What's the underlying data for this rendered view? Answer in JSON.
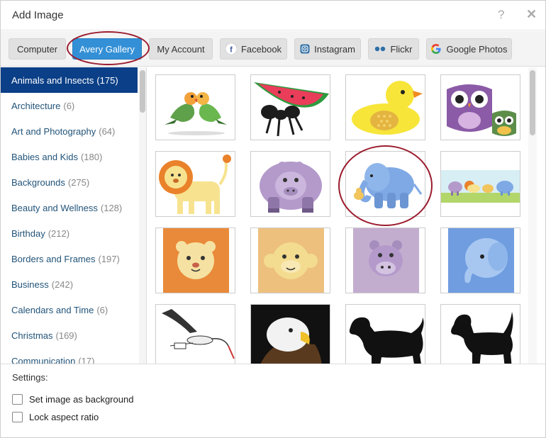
{
  "title": "Add Image",
  "tabs": [
    {
      "label": "Computer",
      "icon": ""
    },
    {
      "label": "Avery Gallery",
      "icon": ""
    },
    {
      "label": "My Account",
      "icon": ""
    },
    {
      "label": "Facebook",
      "icon": "facebook-icon"
    },
    {
      "label": "Instagram",
      "icon": "instagram-icon"
    },
    {
      "label": "Flickr",
      "icon": "flickr-icon"
    },
    {
      "label": "Google Photos",
      "icon": "google-icon"
    }
  ],
  "active_tab": "Avery Gallery",
  "categories": [
    {
      "name": "Animals and Insects",
      "count": "(175)"
    },
    {
      "name": "Architecture",
      "count": "(6)"
    },
    {
      "name": "Art and Photography",
      "count": "(64)"
    },
    {
      "name": "Babies and Kids",
      "count": "(180)"
    },
    {
      "name": "Backgrounds",
      "count": "(275)"
    },
    {
      "name": "Beauty and Wellness",
      "count": "(128)"
    },
    {
      "name": "Birthday",
      "count": "(212)"
    },
    {
      "name": "Borders and Frames",
      "count": "(197)"
    },
    {
      "name": "Business",
      "count": "(242)"
    },
    {
      "name": "Calendars and Time",
      "count": "(6)"
    },
    {
      "name": "Christmas",
      "count": "(169)"
    },
    {
      "name": "Communication",
      "count": "(17)"
    }
  ],
  "active_category": "Animals and Insects",
  "gallery": {
    "images": [
      "lovebirds",
      "watermelon-ant",
      "rubber-duck",
      "owls",
      "lion",
      "hippo",
      "elephant",
      "animal-parade",
      "lion-face",
      "monkey-face",
      "hippo-face",
      "elephant-face",
      "stork",
      "bald-eagle",
      "basset-hound-silhouette",
      "beagle-silhouette"
    ]
  },
  "settings": {
    "title": "Settings:",
    "options": [
      {
        "label": "Set image as background",
        "checked": false
      },
      {
        "label": "Lock aspect ratio",
        "checked": false
      }
    ]
  },
  "colors": {
    "accent": "#3390d6",
    "active_category_bg": "#0b3f87",
    "highlight_ring": "#9b1c2e",
    "link_text": "#22547a"
  }
}
